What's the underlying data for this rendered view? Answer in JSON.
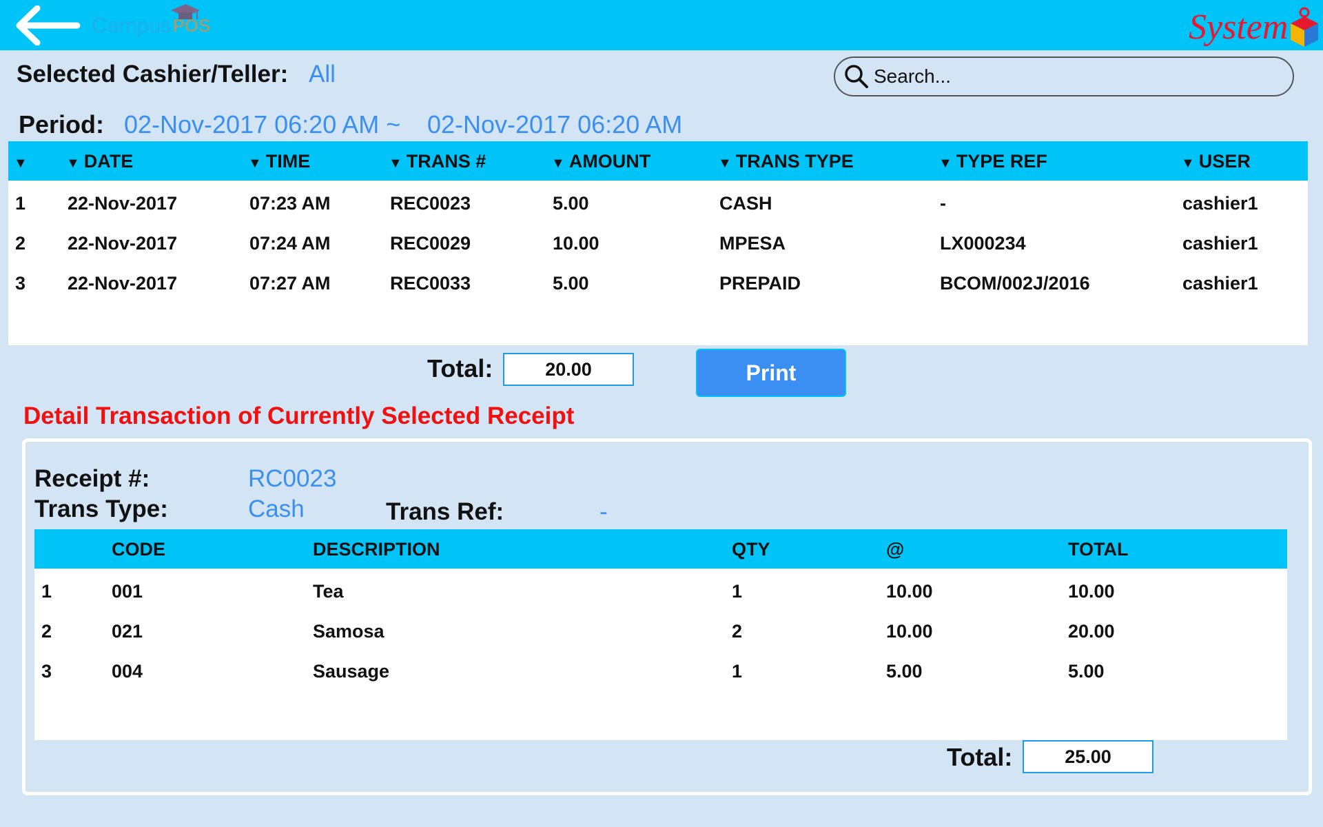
{
  "header": {
    "logo_text": "Campus",
    "logo_suffix": "POS",
    "vendor_logo_text": "System",
    "back_icon": "arrow-left-icon",
    "accent_color": "#00c3f8"
  },
  "filters": {
    "cashier_label": "Selected Cashier/Teller:",
    "cashier_value": "All",
    "search_placeholder": "Search...",
    "period_label": "Period:",
    "period_from": "02-Nov-2017 06:20 AM ~",
    "period_to": "02-Nov-2017 06:20 AM"
  },
  "transactions": {
    "columns": [
      "",
      "DATE",
      "TIME",
      "TRANS #",
      "AMOUNT",
      "TRANS TYPE",
      "TYPE REF",
      "USER"
    ],
    "rows": [
      [
        "1",
        "22-Nov-2017",
        "07:23 AM",
        "REC0023",
        "5.00",
        "CASH",
        "-",
        "cashier1"
      ],
      [
        "2",
        "22-Nov-2017",
        "07:24 AM",
        "REC0029",
        "10.00",
        "MPESA",
        "LX000234",
        "cashier1"
      ],
      [
        "3",
        "22-Nov-2017",
        "07:27 AM",
        "REC0033",
        "5.00",
        "PREPAID",
        "BCOM/002J/2016",
        "cashier1"
      ]
    ],
    "total_label": "Total:",
    "total_value": "20.00",
    "print_label": "Print"
  },
  "detail": {
    "title": "Detail Transaction of Currently Selected Receipt",
    "title_color": "#f01010",
    "receipt_label": "Receipt #:",
    "receipt_value": "RC0023",
    "trans_type_label": "Trans Type:",
    "trans_type_value": "Cash",
    "trans_ref_label": "Trans Ref:",
    "trans_ref_value": "-",
    "columns": [
      "",
      "CODE",
      "DESCRIPTION",
      "QTY",
      "@",
      "TOTAL"
    ],
    "rows": [
      [
        "1",
        "001",
        "Tea",
        "1",
        "10.00",
        "10.00"
      ],
      [
        "2",
        "021",
        "Samosa",
        "2",
        "10.00",
        "20.00"
      ],
      [
        "3",
        "004",
        "Sausage",
        "1",
        "5.00",
        "5.00"
      ]
    ],
    "total_label": "Total:",
    "total_value": "25.00"
  }
}
